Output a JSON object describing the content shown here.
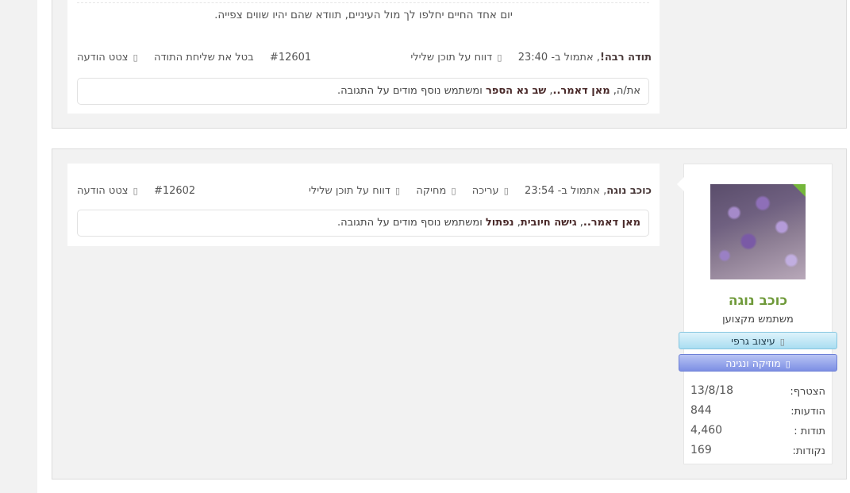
{
  "posts": [
    {
      "quote_text": "יום אחד החיים יחלפו לך מול העיניים, תוודא שהם יהיו שווים צפייה.",
      "meta": {
        "author_label": "תודה רבה!",
        "time_text": ", אתמול ב- 23:40",
        "report_label": "דווח על תוכן שלילי",
        "post_number": "#12601",
        "cancel_thanks_label": "בטל את שליחת התודה",
        "quote_label": "צטט הודעה"
      },
      "thanks": {
        "prefix": "את/ה, ",
        "user1": "מאן דאמר..",
        "comma": ", ",
        "user2": "שב נא הספר",
        "suffix": " ומשתמש נוסף מודים על התגובה."
      }
    },
    {
      "meta": {
        "author_label": "כוכב נוגה",
        "time_text": ", אתמול ב- 23:54",
        "edit_label": "עריכה",
        "delete_label": "מחיקה",
        "report_label": "דווח על תוכן שלילי",
        "post_number": "#12602",
        "quote_label": "צטט הודעה"
      },
      "thanks": {
        "user1": "מאן דאמר..",
        "comma1": ", ",
        "user2": "גישה חיובית",
        "comma2": ", ",
        "user3": "נפתול",
        "suffix": " ומשתמש נוסף מודים על התגובה."
      },
      "user_card": {
        "avatar_icon": "lavender-avatar",
        "username": "כוכב נוגה",
        "user_title": "משתמש מקצוען",
        "ribbons": [
          {
            "label": "עיצוב גרפי",
            "icon": "brush-icon"
          },
          {
            "label": "מוזיקה ונגינה",
            "icon": "music-icon"
          }
        ],
        "stats": [
          {
            "key": "הצטרף:",
            "value": "13/8/18"
          },
          {
            "key": "הודעות:",
            "value": "844"
          },
          {
            "key": "תודות :",
            "value": "4,460"
          },
          {
            "key": "נקודות:",
            "value": "169"
          }
        ]
      }
    }
  ],
  "glyph": "▯",
  "colors": {
    "username": "#6f9a3a",
    "link": "#4a2a2a",
    "panel_bg": "#f2f2f2"
  }
}
